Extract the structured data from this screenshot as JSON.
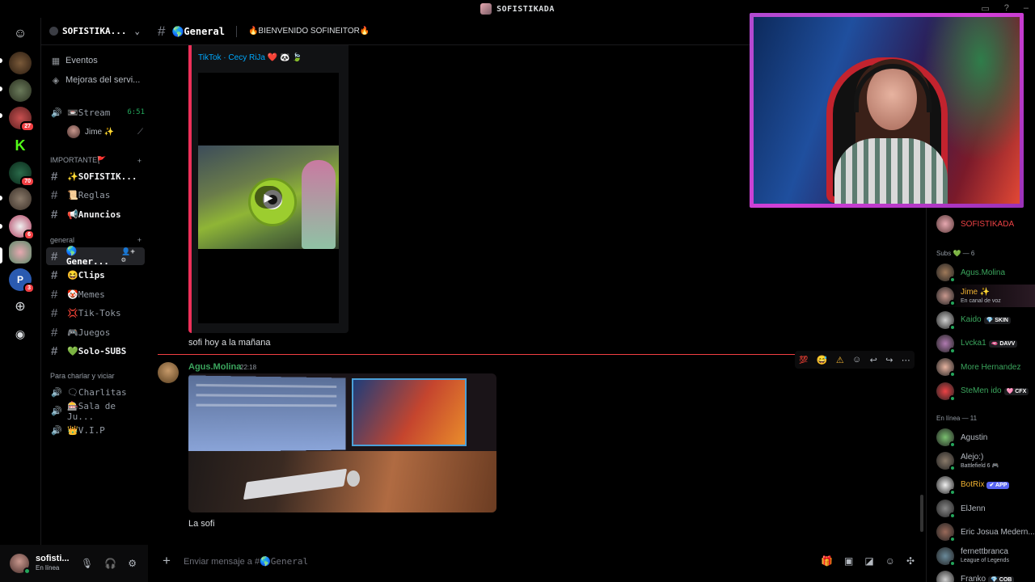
{
  "window": {
    "title": "SOFISTIKADA"
  },
  "server_rail": [
    {
      "name": "discord-home-icon"
    },
    {
      "name": "server-1"
    },
    {
      "name": "server-2"
    },
    {
      "name": "server-3",
      "badge": "27"
    },
    {
      "name": "server-kick"
    },
    {
      "name": "server-4",
      "badge": "70"
    },
    {
      "name": "server-5"
    },
    {
      "name": "server-6",
      "badge": "6"
    },
    {
      "name": "server-sofistikada"
    },
    {
      "name": "server-7",
      "badge": "3"
    },
    {
      "name": "add-server-icon"
    },
    {
      "name": "discover-icon"
    }
  ],
  "sidebar": {
    "guild_name": "SOFISTIKA...",
    "events_label": "Eventos",
    "boosts_label": "Mejoras del servi...",
    "voice_stream": {
      "label": "📼Stream",
      "duration": "6:51",
      "member": "Jime ✨"
    },
    "cat_importante": "IMPORTANTE🚩",
    "cat_general": "general",
    "cat_charlar": "Para charlar y viciar",
    "channels_importante": [
      {
        "label": "✨SOFISTIK...",
        "unread": true
      },
      {
        "label": "📜Reglas",
        "unread": false
      },
      {
        "label": "📢Anuncios",
        "unread": true
      }
    ],
    "channels_general": [
      {
        "label": "🌎Gener...",
        "active": true
      },
      {
        "label": "😆Clips",
        "unread": true
      },
      {
        "label": "🤡Memes",
        "unread": false
      },
      {
        "label": "💢Tik-Toks",
        "unread": false
      },
      {
        "label": "🎮Juegos",
        "unread": false
      },
      {
        "label": "💚Solo-SUBS",
        "unread": true
      }
    ],
    "voice_channels": [
      {
        "label": "🗨Charlitas"
      },
      {
        "label": "🎰Sala de Ju..."
      },
      {
        "label": "👑V.I.P"
      }
    ]
  },
  "user_panel": {
    "name": "sofisti...",
    "status": "En línea"
  },
  "chat_header": {
    "channel": "🌎General",
    "topic": "🔥BIENVENIDO SOFINEITOR🔥"
  },
  "messages": {
    "embed_author": "TikTok · Cecy RiJa ❤️ 🐼 🍃",
    "msg1_text": "sofi hoy a la mañana",
    "msg2_author": "Agus.Molina",
    "msg2_time": "22:18",
    "msg2_text": "La sofi"
  },
  "composer": {
    "placeholder_prefix": "Enviar mensaje a #",
    "placeholder_channel": "🌎General"
  },
  "members": {
    "owner": "SOFISTIKADA",
    "subs_label": "Subs 💚 — 6",
    "online_label": "En línea — 11",
    "subs": [
      {
        "name": "Agus.Molina",
        "color": "#3ba55d"
      },
      {
        "name": "Jime ✨",
        "color": "#f0b232",
        "sub": "En canal de voz"
      },
      {
        "name": "Kaido",
        "color": "#3ba55d",
        "tag": "💎 SKIN"
      },
      {
        "name": "Lvcka1",
        "color": "#3ba55d",
        "tag": "🫦 DAVV"
      },
      {
        "name": "More Hernandez",
        "color": "#3ba55d"
      },
      {
        "name": "SteMen ido",
        "color": "#3ba55d",
        "tag": "🩷 CFX"
      }
    ],
    "online": [
      {
        "name": "Agustin",
        "color": "#b5bac1"
      },
      {
        "name": "Alejo:)",
        "color": "#b5bac1",
        "sub": "Battlefield 6 🎮"
      },
      {
        "name": "BotRix",
        "color": "#f0b232",
        "tag": "✔ APP",
        "app": true
      },
      {
        "name": "ElJenn",
        "color": "#b5bac1"
      },
      {
        "name": "Eric Josua Medern...",
        "color": "#b5bac1"
      },
      {
        "name": "fernettbranca",
        "color": "#b5bac1",
        "sub": "League of Legends"
      },
      {
        "name": "Franko",
        "color": "#b5bac1",
        "tag": "💎 COB"
      }
    ]
  },
  "colors": {
    "accent_green": "#3ba55d",
    "owner_red": "#ed4245",
    "divider_red": "#f23f43",
    "webcam_border": "#c23ed2"
  }
}
